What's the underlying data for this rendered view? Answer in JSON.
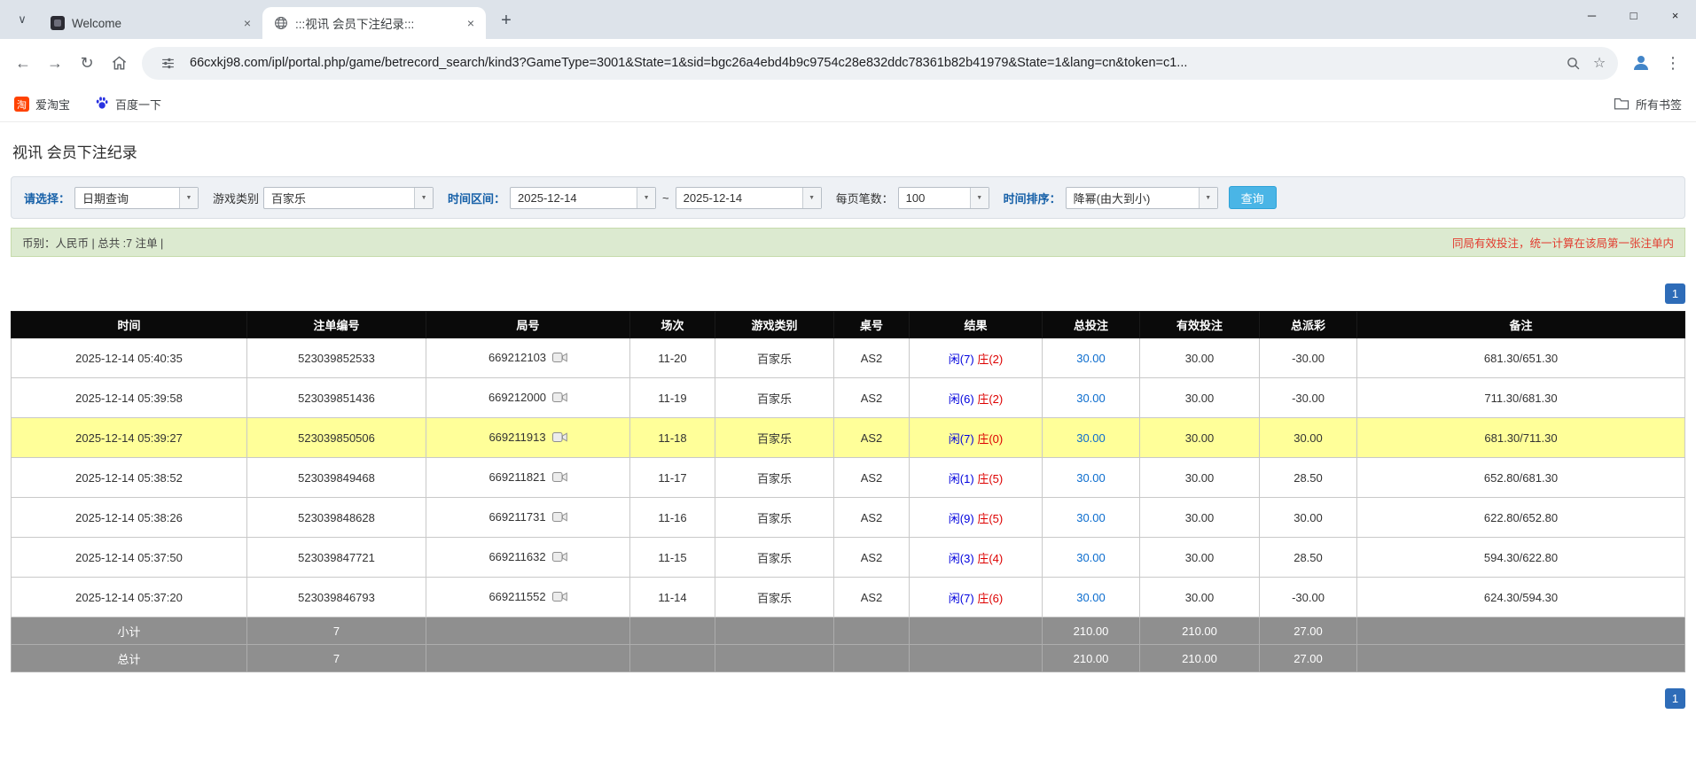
{
  "colors": {
    "label_blue": "#1660a8",
    "search_blue": "#4ab5e6",
    "note_red": "#e23b2e",
    "pager_blue": "#2e6cb8",
    "highlight_yellow": "#ffff99",
    "player_blue": "#0000dd",
    "banker_red": "#dd0000",
    "link_blue": "#0b6cce"
  },
  "icons": {
    "chevron_down": "∨",
    "close": "×",
    "minimize": "─",
    "maximize": "□",
    "plus": "+",
    "back": "←",
    "forward": "→",
    "refresh": "↻",
    "star": "☆",
    "menu": "⋮",
    "dropdown": "▼"
  },
  "browser": {
    "tabs": [
      {
        "title": "Welcome"
      },
      {
        "title": ":::视讯 会员下注纪录:::"
      }
    ],
    "url": "66cxkj98.com/ipl/portal.php/game/betrecord_search/kind3?GameType=3001&State=1&sid=bgc26a4ebd4b9c9754c28e832ddc78361b82b41979&State=1&lang=cn&token=c1...",
    "bookmarks": [
      {
        "label": "爱淘宝",
        "badge": "淘"
      },
      {
        "label": "百度一下"
      }
    ],
    "all_bookmarks": "所有书签"
  },
  "page": {
    "title": "视讯 会员下注纪录",
    "filters": {
      "select_label": "请选择：",
      "select_value": "日期查询",
      "game_label": "游戏类别",
      "game_value": "百家乐",
      "range_label": "时间区间：",
      "date_from": "2025-12-14",
      "range_sep": "~",
      "date_to": "2025-12-14",
      "page_size_label": "每页笔数：",
      "page_size_value": "100",
      "sort_label": "时间排序：",
      "sort_value": "降幂(由大到小)",
      "search_button": "查询"
    },
    "summary_left": "币别：人民币 | 总共 :7 注单 |",
    "summary_right": "同局有效投注，统一计算在该局第一张注单内",
    "pagination": "1",
    "table": {
      "headers": [
        "时间",
        "注单编号",
        "局号",
        "场次",
        "游戏类别",
        "桌号",
        "结果",
        "总投注",
        "有效投注",
        "总派彩",
        "备注"
      ],
      "rows": [
        {
          "time": "2025-12-14 05:40:35",
          "bet_id": "523039852533",
          "round": "669212103",
          "session": "11-20",
          "game": "百家乐",
          "table_no": "AS2",
          "player": "闲(7)",
          "banker": "庄(2)",
          "total_bet": "30.00",
          "valid_bet": "30.00",
          "payout": "-30.00",
          "payout_negative": true,
          "remark": "681.30/651.30",
          "highlighted": false
        },
        {
          "time": "2025-12-14 05:39:58",
          "bet_id": "523039851436",
          "round": "669212000",
          "session": "11-19",
          "game": "百家乐",
          "table_no": "AS2",
          "player": "闲(6)",
          "banker": "庄(2)",
          "total_bet": "30.00",
          "valid_bet": "30.00",
          "payout": "-30.00",
          "payout_negative": true,
          "remark": "711.30/681.30",
          "highlighted": false
        },
        {
          "time": "2025-12-14 05:39:27",
          "bet_id": "523039850506",
          "round": "669211913",
          "session": "11-18",
          "game": "百家乐",
          "table_no": "AS2",
          "player": "闲(7)",
          "banker": "庄(0)",
          "total_bet": "30.00",
          "valid_bet": "30.00",
          "payout": "30.00",
          "payout_negative": false,
          "remark": "681.30/711.30",
          "highlighted": true
        },
        {
          "time": "2025-12-14 05:38:52",
          "bet_id": "523039849468",
          "round": "669211821",
          "session": "11-17",
          "game": "百家乐",
          "table_no": "AS2",
          "player": "闲(1)",
          "banker": "庄(5)",
          "total_bet": "30.00",
          "valid_bet": "30.00",
          "payout": "28.50",
          "payout_negative": false,
          "remark": "652.80/681.30",
          "highlighted": false
        },
        {
          "time": "2025-12-14 05:38:26",
          "bet_id": "523039848628",
          "round": "669211731",
          "session": "11-16",
          "game": "百家乐",
          "table_no": "AS2",
          "player": "闲(9)",
          "banker": "庄(5)",
          "total_bet": "30.00",
          "valid_bet": "30.00",
          "payout": "30.00",
          "payout_negative": false,
          "remark": "622.80/652.80",
          "highlighted": false
        },
        {
          "time": "2025-12-14 05:37:50",
          "bet_id": "523039847721",
          "round": "669211632",
          "session": "11-15",
          "game": "百家乐",
          "table_no": "AS2",
          "player": "闲(3)",
          "banker": "庄(4)",
          "total_bet": "30.00",
          "valid_bet": "30.00",
          "payout": "28.50",
          "payout_negative": false,
          "remark": "594.30/622.80",
          "highlighted": false
        },
        {
          "time": "2025-12-14 05:37:20",
          "bet_id": "523039846793",
          "round": "669211552",
          "session": "11-14",
          "game": "百家乐",
          "table_no": "AS2",
          "player": "闲(7)",
          "banker": "庄(6)",
          "total_bet": "30.00",
          "valid_bet": "30.00",
          "payout": "-30.00",
          "payout_negative": true,
          "remark": "624.30/594.30",
          "highlighted": false
        }
      ],
      "subtotal": {
        "label": "小计",
        "count": "7",
        "total_bet": "210.00",
        "valid_bet": "210.00",
        "payout": "27.00"
      },
      "total": {
        "label": "总计",
        "count": "7",
        "total_bet": "210.00",
        "valid_bet": "210.00",
        "payout": "27.00"
      }
    }
  }
}
